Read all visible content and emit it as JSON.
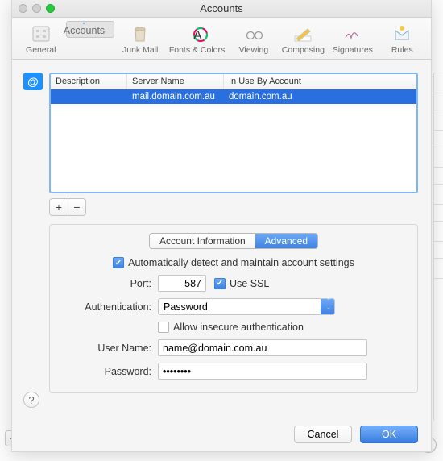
{
  "window": {
    "title": "Accounts"
  },
  "toolbar": {
    "general": "General",
    "accounts": "Accounts",
    "junk": "Junk Mail",
    "fonts": "Fonts & Colors",
    "viewing": "Viewing",
    "composing": "Composing",
    "signatures": "Signatures",
    "rules": "Rules"
  },
  "list": {
    "col1": "Description",
    "col2": "Server Name",
    "col3": "In Use By Account",
    "row": {
      "desc": "",
      "server": "mail.domain.com.au",
      "inuse": "domain.com.au"
    }
  },
  "tabs": {
    "info": "Account Information",
    "adv": "Advanced"
  },
  "form": {
    "autodetect": "Automatically detect and maintain account settings",
    "port_label": "Port:",
    "port_value": "587",
    "usessl": "Use SSL",
    "auth_label": "Authentication:",
    "auth_value": "Password",
    "insecure": "Allow insecure authentication",
    "user_label": "User Name:",
    "user_value": "name@domain.com.au",
    "pass_label": "Password:",
    "pass_value": "••••••••"
  },
  "buttons": {
    "cancel": "Cancel",
    "ok": "OK"
  },
  "glyph": {
    "at": "@",
    "plus": "+",
    "minus": "−",
    "q": "?"
  }
}
